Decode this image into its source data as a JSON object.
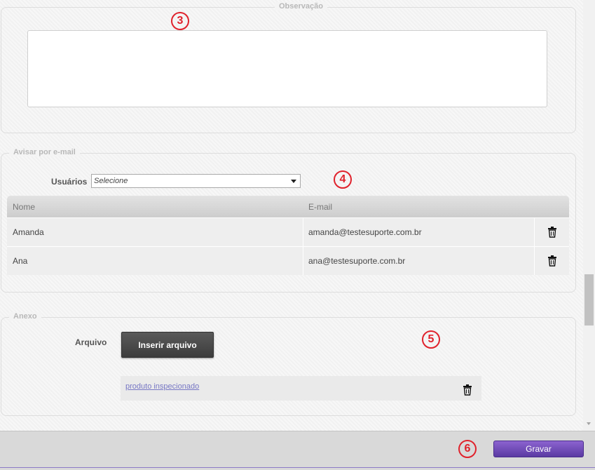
{
  "observacao": {
    "legend": "Observação",
    "annotation": "3",
    "text": ""
  },
  "avisar": {
    "legend": "Avisar por e-mail",
    "annotation": "4",
    "usuarios_label": "Usuários",
    "select_value": "Selecione",
    "columns": [
      "Nome",
      "E-mail"
    ],
    "rows": [
      {
        "nome": "Amanda",
        "email": "amanda@testesuporte.com.br"
      },
      {
        "nome": "Ana",
        "email": "ana@testesuporte.com.br"
      }
    ]
  },
  "anexo": {
    "legend": "Anexo",
    "annotation": "5",
    "arquivo_label": "Arquivo",
    "insert_button": "Inserir arquivo",
    "file_link": "produto inspecionado"
  },
  "footer": {
    "annotation": "6",
    "save_button": "Gravar"
  },
  "colors": {
    "annotation": "#e0222c",
    "save_button": "#6d49b8",
    "link": "#7777c4"
  },
  "icons": {
    "delete": "trash-icon",
    "dropdown": "chevron-down-icon"
  }
}
